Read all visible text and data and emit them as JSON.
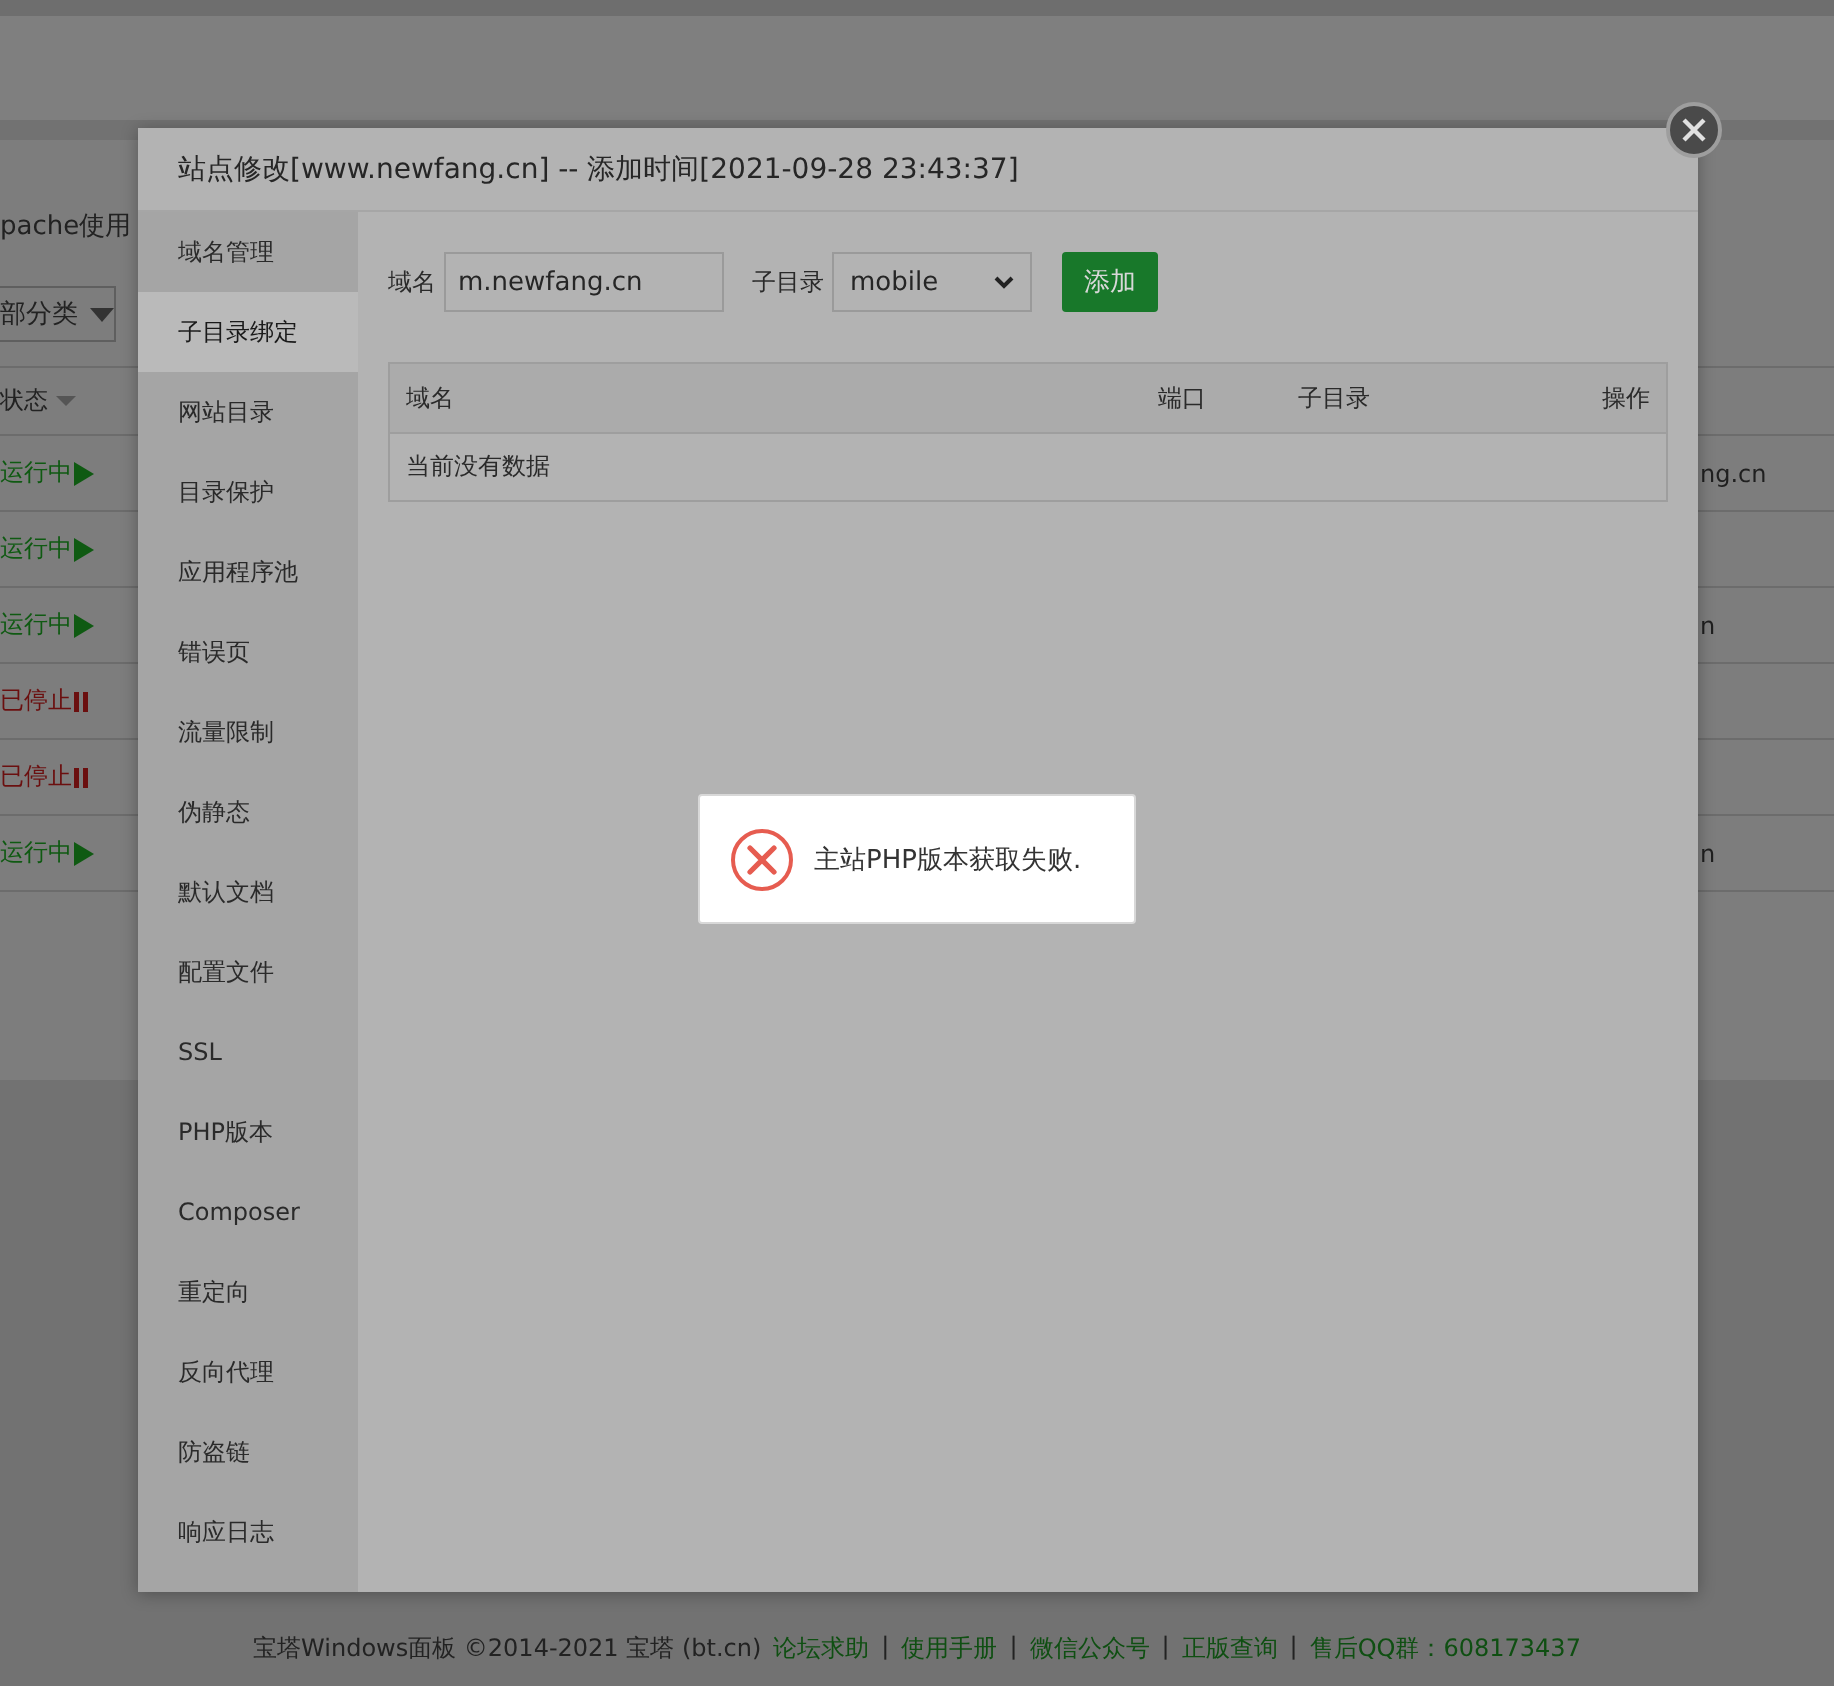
{
  "background_page": {
    "notice_text": "pache使用",
    "category_dropdown": "部分类",
    "status_column": "状态",
    "rows": [
      {
        "status": "运行中",
        "running": true,
        "column_2": "ng.cn"
      },
      {
        "status": "运行中",
        "running": true
      },
      {
        "status": "运行中",
        "running": true,
        "column_2": "n"
      },
      {
        "status": "已停止",
        "running": false
      },
      {
        "status": "已停止",
        "running": false
      },
      {
        "status": "运行中",
        "running": true,
        "column_2": "n"
      }
    ],
    "footer": {
      "copyright": "宝塔Windows面板 ©2014-2021 宝塔 (bt.cn)",
      "links": [
        "论坛求助",
        "使用手册",
        "微信公众号",
        "正版查询",
        "售后QQ群：608173437"
      ],
      "separator": "|"
    }
  },
  "dialog": {
    "title": "站点修改[www.newfang.cn] -- 添加时间[2021-09-28 23:43:37]",
    "sidebar": {
      "items": [
        {
          "label": "域名管理",
          "selected": false
        },
        {
          "label": "子目录绑定",
          "selected": true
        },
        {
          "label": "网站目录",
          "selected": false
        },
        {
          "label": "目录保护",
          "selected": false
        },
        {
          "label": "应用程序池",
          "selected": false
        },
        {
          "label": "错误页",
          "selected": false
        },
        {
          "label": "流量限制",
          "selected": false
        },
        {
          "label": "伪静态",
          "selected": false
        },
        {
          "label": "默认文档",
          "selected": false
        },
        {
          "label": "配置文件",
          "selected": false
        },
        {
          "label": "SSL",
          "selected": false
        },
        {
          "label": "PHP版本",
          "selected": false
        },
        {
          "label": "Composer",
          "selected": false
        },
        {
          "label": "重定向",
          "selected": false
        },
        {
          "label": "反向代理",
          "selected": false
        },
        {
          "label": "防盗链",
          "selected": false
        },
        {
          "label": "响应日志",
          "selected": false
        }
      ]
    },
    "form": {
      "domain_label": "域名",
      "domain_value": "m.newfang.cn",
      "subdir_label": "子目录",
      "subdir_value": "mobile",
      "add_button": "添加"
    },
    "table": {
      "columns": [
        "域名",
        "端口",
        "子目录",
        "操作"
      ],
      "empty_text": "当前没有数据"
    }
  },
  "toast": {
    "kind": "error",
    "message": "主站PHP版本获取失败."
  }
}
